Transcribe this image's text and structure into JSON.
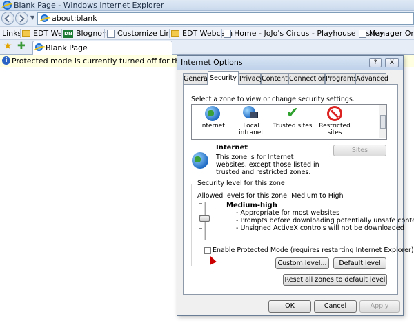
{
  "browser": {
    "title": "Blank Page - Windows Internet Explorer",
    "address": "about:blank",
    "links_label": "Links",
    "links": [
      "EDT Web",
      "Blognone",
      "Customize Links",
      "EDT Webcam",
      "Home - JoJo's Circus - Playhouse Disney",
      "Manager Online"
    ],
    "tab_title": "Blank Page",
    "infobar_text": "Protected mode is currently turned off for the Internet zone."
  },
  "dialog": {
    "title": "Internet Options",
    "help_btn": "?",
    "close_btn": "X",
    "tabs": [
      "General",
      "Security",
      "Privacy",
      "Content",
      "Connections",
      "Programs",
      "Advanced"
    ],
    "active_tab": "Security",
    "zone_prompt": "Select a zone to view or change security settings.",
    "zones": [
      {
        "label": "Internet",
        "icon": "globe-icon"
      },
      {
        "label": "Local intranet",
        "icon": "intranet-icon"
      },
      {
        "label": "Trusted sites",
        "icon": "checkmark-icon"
      },
      {
        "label": "Restricted sites",
        "icon": "no-entry-icon"
      }
    ],
    "selected_zone_title": "Internet",
    "selected_zone_desc": "This zone is for Internet websites, except those listed in trusted and restricted zones.",
    "sites_btn": "Sites",
    "security_group_label": "Security level for this zone",
    "allowed_levels": "Allowed levels for this zone: Medium to High",
    "level_name": "Medium-high",
    "level_bullets": [
      "- Appropriate for most websites",
      "- Prompts before downloading potentially unsafe content",
      "- Unsigned ActiveX controls will not be downloaded"
    ],
    "protected_mode_label": "Enable Protected Mode (requires restarting Internet Explorer)",
    "protected_mode_checked": false,
    "custom_level_btn": "Custom level...",
    "default_level_btn": "Default level",
    "reset_all_btn": "Reset all zones to default level",
    "ok_btn": "OK",
    "cancel_btn": "Cancel",
    "apply_btn": "Apply"
  }
}
